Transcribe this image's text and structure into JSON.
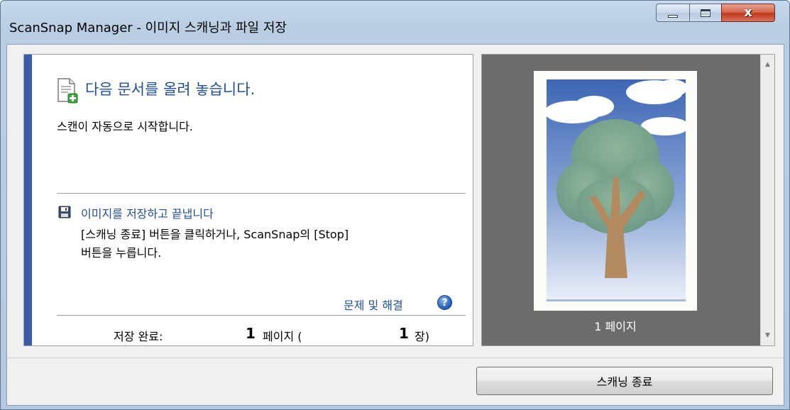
{
  "window": {
    "title": "ScanSnap Manager - 이미지 스캐닝과 파일 저장",
    "minimize_icon": "minimize-icon",
    "maximize_icon": "maximize-icon",
    "close_label": "x"
  },
  "instructions": {
    "heading": "다음 문서를 올려 놓습니다.",
    "subtext": "스캔이 자동으로 시작합니다.",
    "save_link": "이미지를 저장하고 끝냅니다",
    "desc_line1": "[스캐닝 종료] 버튼을 클릭하거나, ScanSnap의 [Stop]",
    "desc_line2": "버튼을 누릅니다.",
    "help_link": "문제 및 해결",
    "help_icon_glyph": "?"
  },
  "status": {
    "label": "저장 완료:",
    "pages": "1",
    "pages_unit": "페이지 (",
    "sheets": "1",
    "sheets_unit": "장)"
  },
  "preview": {
    "page_label": "1 페이지"
  },
  "buttons": {
    "finish_scan": "스캐닝 종료"
  },
  "colors": {
    "accent_blue": "#1f4ea0",
    "stripe_blue": "#3a5ba8",
    "preview_bg": "#6c6c6c"
  }
}
